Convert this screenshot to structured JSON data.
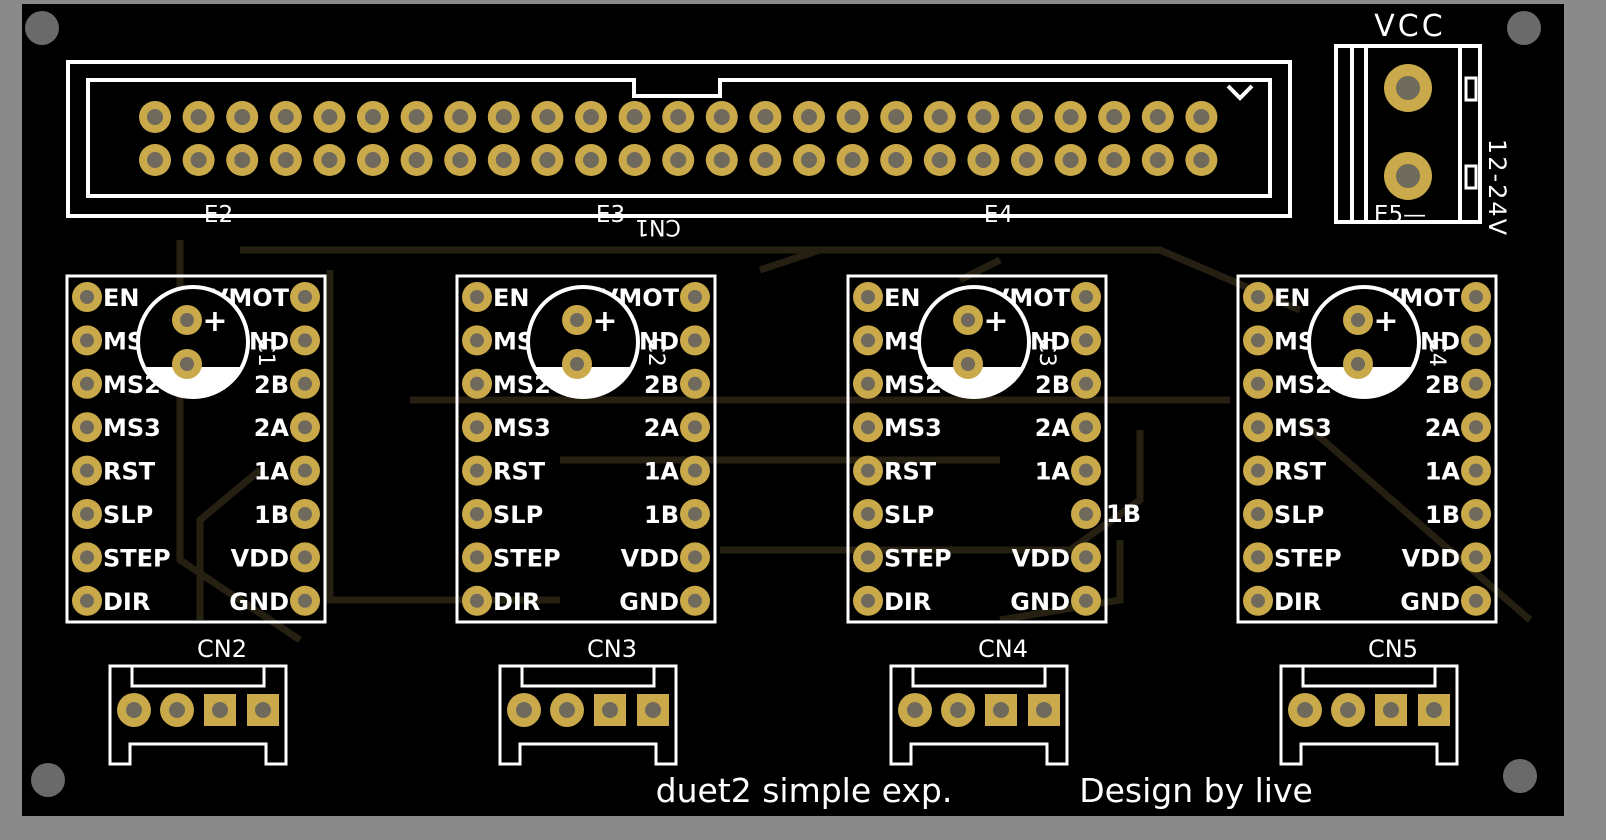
{
  "header": {
    "title": "CN1",
    "bank_labels": [
      "E2",
      "E3",
      "E4"
    ],
    "pin_rows": 2,
    "pins_per_row": 25
  },
  "power": {
    "title": "VCC",
    "voltage": "12-24V",
    "label": "E5"
  },
  "drivers": [
    {
      "name": "C1",
      "connector": "CN2"
    },
    {
      "name": "C2",
      "connector": "CN3"
    },
    {
      "name": "C3",
      "connector": "CN4"
    },
    {
      "name": "C4",
      "connector": "CN5"
    }
  ],
  "left_pins": [
    "EN",
    "MS1",
    "MS2",
    "MS3",
    "RST",
    "SLP",
    "STEP",
    "DIR"
  ],
  "right_pins": [
    "VMOT",
    "GND",
    "2B",
    "2A",
    "1A",
    "1B",
    "VDD",
    "GND"
  ],
  "stray_label": "1B",
  "capacitor_polarity": "+",
  "footer": {
    "caption": "duet2 simple exp.",
    "credit": "Design by live"
  },
  "colors": {
    "board": "#000000",
    "silkscreen": "#ffffff",
    "pad_gold": "#c9a94a",
    "pad_hole": "#6f6a5c",
    "trace": "#2a2414",
    "mount_hole": "#6a6a6a"
  }
}
